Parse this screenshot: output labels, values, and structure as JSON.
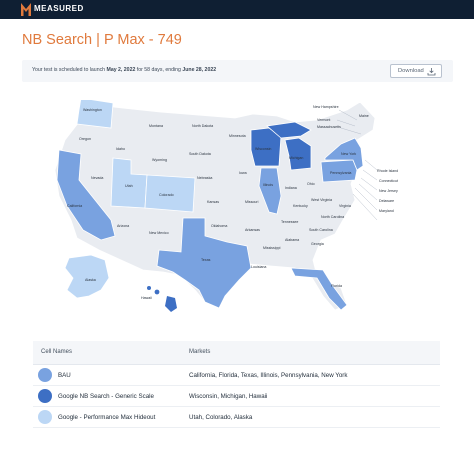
{
  "brand": {
    "name": "MEASURED"
  },
  "page": {
    "title": "NB Search | P Max - 749"
  },
  "notice": {
    "prefix": "Your test is scheduled to launch ",
    "start_date": "May 2, 2022",
    "middle": " for 58 days, ending ",
    "end_date": "June 28, 2022"
  },
  "download": {
    "label": "Download",
    "icon": "download-icon"
  },
  "colors": {
    "bau": "#79a2e0",
    "generic_scale": "#3d6fc4",
    "pmax_hideout": "#bcd7f5",
    "unassigned": "#e9ecf1",
    "brand_orange": "#e07a3d",
    "topbar": "#0f1f33"
  },
  "map": {
    "state_labels": {
      "washington": "Washington",
      "oregon": "Oregon",
      "california": "California",
      "nevada": "Nevada",
      "idaho": "Idaho",
      "montana": "Montana",
      "wyoming": "Wyoming",
      "utah": "Utah",
      "arizona": "Arizona",
      "colorado": "Colorado",
      "new_mexico": "New Mexico",
      "north_dakota": "North Dakota",
      "south_dakota": "South Dakota",
      "nebraska": "Nebraska",
      "kansas": "Kansas",
      "oklahoma": "Oklahoma",
      "texas": "Texas",
      "minnesota": "Minnesota",
      "iowa": "Iowa",
      "missouri": "Missouri",
      "arkansas": "Arkansas",
      "louisiana": "Louisiana",
      "wisconsin": "Wisconsin",
      "illinois": "Illinois",
      "michigan": "Michigan",
      "indiana": "Indiana",
      "ohio": "Ohio",
      "kentucky": "Kentucky",
      "tennessee": "Tennessee",
      "mississippi": "Mississippi",
      "alabama": "Alabama",
      "georgia": "Georgia",
      "florida": "Florida",
      "south_carolina": "South Carolina",
      "north_carolina": "North Carolina",
      "virginia": "Virginia",
      "west_virginia": "West Virginia",
      "pennsylvania": "Pennsylvania",
      "new_york": "New York",
      "vermont": "Vermont",
      "new_hampshire": "New Hampshire",
      "maine": "Maine",
      "massachusetts": "Massachusetts",
      "rhode_island": "Rhode Island",
      "connecticut": "Connecticut",
      "new_jersey": "New Jersey",
      "delaware": "Delaware",
      "maryland": "Maryland",
      "alaska": "Alaska",
      "hawaii": "Hawaii"
    }
  },
  "legend": {
    "headers": {
      "cell_names": "Cell Names",
      "markets": "Markets"
    },
    "rows": [
      {
        "name": "BAU",
        "markets": "California, Florida, Texas, Illinois, Pennsylvania, New York",
        "color": "#79a2e0"
      },
      {
        "name": "Google NB Search - Generic Scale",
        "markets": "Wisconsin, Michigan, Hawaii",
        "color": "#3d6fc4"
      },
      {
        "name": "Google - Performance Max Hideout",
        "markets": "Utah, Colorado, Alaska",
        "color": "#bcd7f5"
      }
    ]
  }
}
